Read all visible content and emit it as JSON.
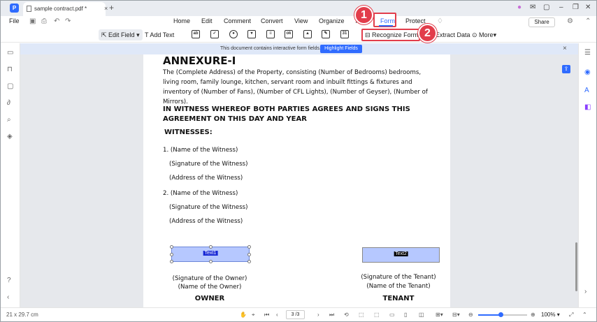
{
  "titlebar": {
    "doc_tab": "sample contract.pdf *",
    "close": "×",
    "new_tab": "+",
    "min": "–",
    "restore": "❐",
    "win_close": "✕"
  },
  "menubar": {
    "file": "File",
    "tabs": [
      "Home",
      "Edit",
      "Comment",
      "Convert",
      "View",
      "Organize",
      "Tools",
      "Form",
      "Protect"
    ],
    "share": "Share"
  },
  "toolbar": {
    "edit_field": "Edit Field",
    "add_text": "Add Text",
    "field_icons": [
      "ab",
      "✓",
      "●",
      "▾",
      "≡",
      "ok",
      "▲",
      "✎",
      "31"
    ],
    "recognize_form": "Recognize Form",
    "extract_data": "Extract Data",
    "more": "More"
  },
  "notice": {
    "text": "This document contains interactive form fields.",
    "button": "Highlight Fields",
    "close": "×"
  },
  "document": {
    "heading": "ANNEXURE-I",
    "paragraph": "The (Complete Address) of the Property, consisting (Number of Bedrooms) bedrooms, living room, family lounge, kitchen, servant room and inbuilt fittings & fixtures and inventory of (Number of Fans), (Number of CFL Lights), (Number of Geyser), (Number of Mirrors).",
    "witness_heading": "IN WITNESS WHEREOF BOTH PARTIES AGREES AND SIGNS THIS AGREEMENT ON THIS DAY AND YEAR",
    "witnesses_label": "WITNESSES:",
    "w1_name": "1. (Name of the Witness)",
    "w1_sig": "(Signature of the Witness)",
    "w1_addr": "(Address of the Witness)",
    "w2_name": "2. (Name of the Witness)",
    "w2_sig": "(Signature of the Witness)",
    "w2_addr": "(Address of the Witness)",
    "field1_label": "Text1",
    "field2_label": "Text2",
    "owner_sig": "(Signature of the Owner)",
    "owner_name": "(Name of the Owner)",
    "owner": "OWNER",
    "tenant_sig": "(Signature of the Tenant)",
    "tenant_name": "(Name of the Tenant)",
    "tenant": "TENANT"
  },
  "annotations": {
    "step1": "1",
    "step2": "2"
  },
  "statusbar": {
    "page_size": "21 x 29.7 cm",
    "page_input": "3 /3",
    "zoom": "100%",
    "zoom_level": 0.45
  }
}
